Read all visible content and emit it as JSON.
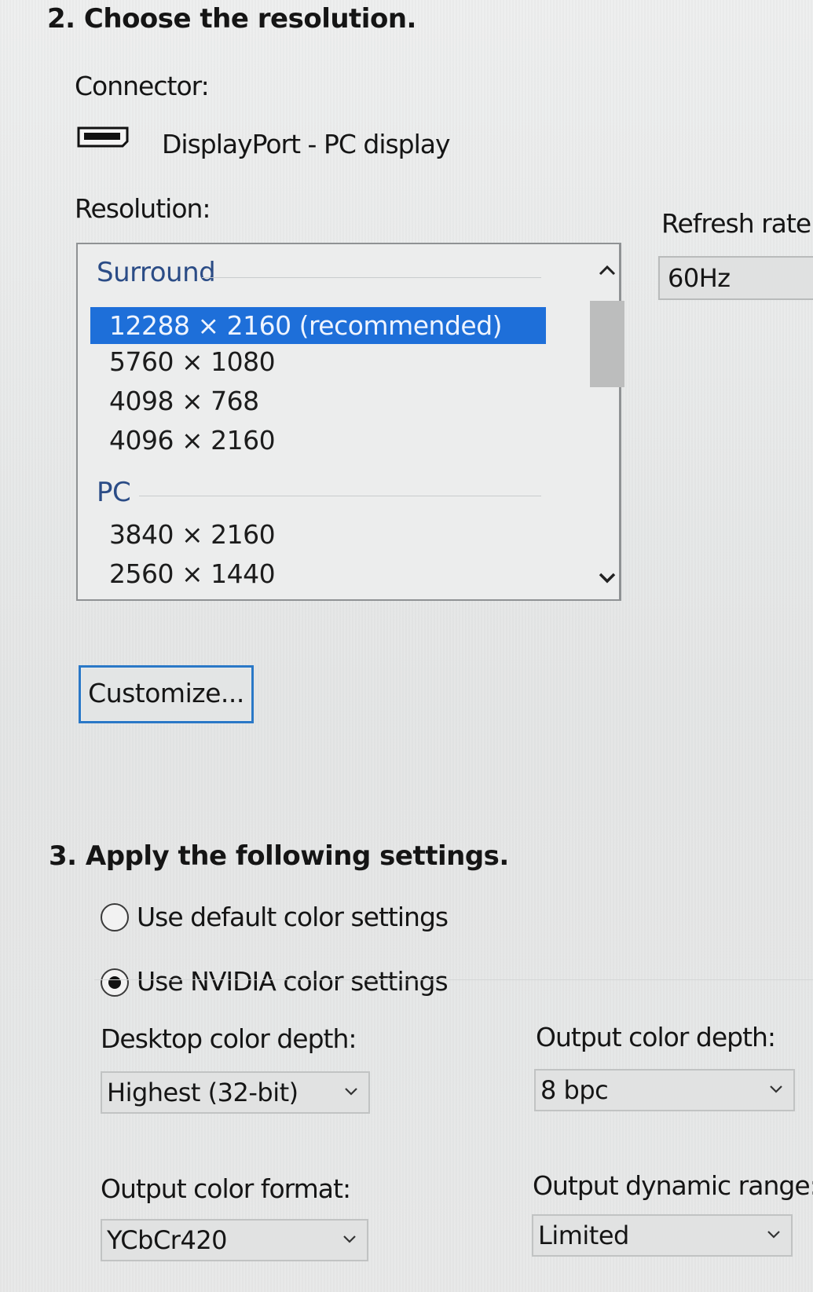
{
  "resolution_section": {
    "title": "2. Choose the resolution.",
    "connector_label": "Connector:",
    "connector_value": "DisplayPort - PC display",
    "connector_icon": "display-port-connector-icon",
    "resolution_label": "Resolution:",
    "refresh_label": "Refresh rate:",
    "refresh_value": "60Hz",
    "groups": [
      {
        "name": "Surround",
        "items": [
          {
            "label": "12288 × 2160 (recommended)",
            "selected": true
          },
          {
            "label": "5760 × 1080",
            "selected": false
          },
          {
            "label": "4098 × 768",
            "selected": false
          },
          {
            "label": "4096 × 2160",
            "selected": false
          }
        ]
      },
      {
        "name": "PC",
        "items": [
          {
            "label": "3840 × 2160",
            "selected": false
          },
          {
            "label": "2560 × 1440",
            "selected": false
          }
        ]
      }
    ],
    "customize_label": "Customize..."
  },
  "apply_section": {
    "title": "3. Apply the following settings.",
    "radio_default_label": "Use default color settings",
    "radio_nvidia_label": "Use NVIDIA color settings",
    "selected_radio": "nvidia",
    "desktop_depth_label": "Desktop color depth:",
    "desktop_depth_value": "Highest (32-bit)",
    "output_depth_label": "Output color depth:",
    "output_depth_value": "8 bpc",
    "output_format_label": "Output color format:",
    "output_format_value": "YCbCr420",
    "dynamic_range_label": "Output dynamic range:",
    "dynamic_range_value": "Limited"
  },
  "colors": {
    "selection": "#1e6fd9",
    "group_header": "#2b4c86",
    "focus_border": "#2a78c7"
  }
}
